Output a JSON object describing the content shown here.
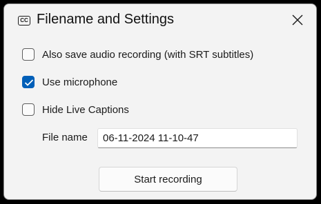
{
  "window": {
    "title": "Filename and Settings",
    "app_icon_text": "CC",
    "icon": "closed-captions-icon",
    "close_icon": "close-icon"
  },
  "options": [
    {
      "label": "Also save audio recording (with SRT subtitles)",
      "checked": false
    },
    {
      "label": "Use microphone",
      "checked": true
    },
    {
      "label": "Hide Live Captions",
      "checked": false
    }
  ],
  "filename": {
    "label": "File name",
    "value": "06-11-2024 11-10-47"
  },
  "start_button": {
    "label": "Start recording"
  },
  "colors": {
    "accent": "#005fb8",
    "window_bg": "#f3f3f3"
  }
}
